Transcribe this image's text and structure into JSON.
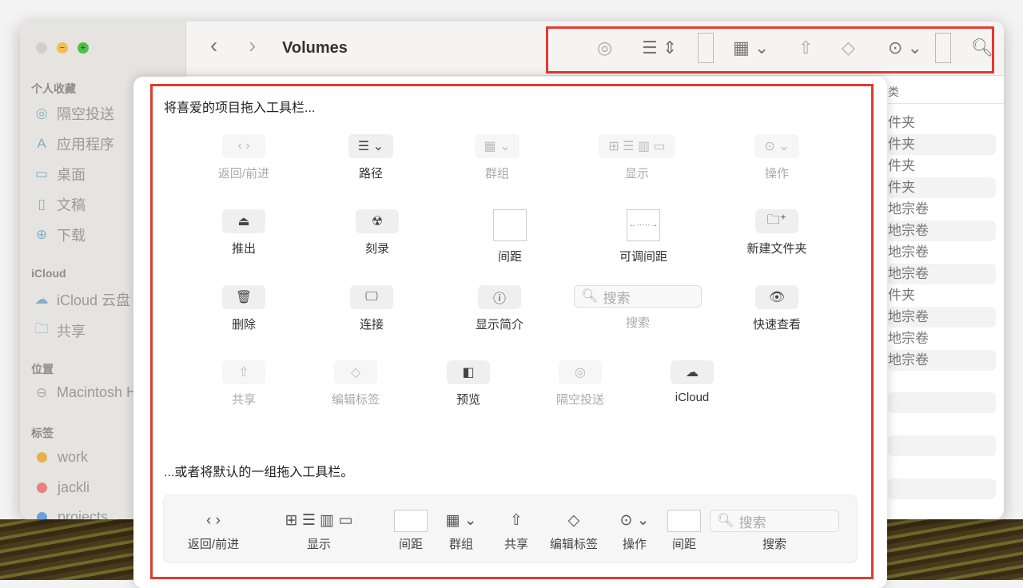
{
  "window": {
    "title": "Volumes"
  },
  "sidebar": {
    "favorites_header": "个人收藏",
    "favorites": [
      {
        "icon": "airdrop-icon",
        "label": "隔空投送"
      },
      {
        "icon": "applications-icon",
        "label": "应用程序"
      },
      {
        "icon": "desktop-icon",
        "label": "桌面"
      },
      {
        "icon": "document-icon",
        "label": "文稿"
      },
      {
        "icon": "download-icon",
        "label": "下载"
      }
    ],
    "icloud_header": "iCloud",
    "icloud": [
      {
        "icon": "cloud-icon",
        "label": "iCloud 云盘"
      },
      {
        "icon": "shared-folder-icon",
        "label": "共享"
      }
    ],
    "locations_header": "位置",
    "locations": [
      {
        "icon": "disk-icon",
        "label": "Macintosh HD"
      }
    ],
    "tags_header": "标签",
    "tags": [
      {
        "label": "work",
        "color": "#e8b04a"
      },
      {
        "label": "jackli",
        "color": "#e98080"
      },
      {
        "label": "projects",
        "color": "#6aa0e0"
      }
    ]
  },
  "list": {
    "column_header": "类",
    "rows": [
      "件夹",
      "件夹",
      "件夹",
      "件夹",
      "地宗卷",
      "地宗卷",
      "地宗卷",
      "地宗卷",
      "件夹",
      "地宗卷",
      "地宗卷",
      "地宗卷"
    ]
  },
  "sheet": {
    "drag_hint": "将喜爱的项目拖入工具栏...",
    "default_hint": "...或者将默认的一组拖入工具栏。",
    "items": [
      {
        "label": "返回/前进",
        "glyph": "‹  ›",
        "dim": true
      },
      {
        "label": "路径",
        "glyph": "☰ ⌄",
        "dim": false
      },
      {
        "label": "群组",
        "glyph": "▦ ⌄",
        "dim": true
      },
      {
        "label": "显示",
        "glyph": "⊞ ☰ ▥ ▭",
        "dim": true
      },
      {
        "label": "操作",
        "glyph": "⊙ ⌄",
        "dim": true
      },
      {
        "label": "推出",
        "glyph": "⏏",
        "dim": false
      },
      {
        "label": "刻录",
        "glyph": "☢",
        "dim": false
      },
      {
        "label": "间距",
        "glyph": "",
        "dim": false
      },
      {
        "label": "可调间距",
        "glyph": "←·····→",
        "dim": false
      },
      {
        "label": "新建文件夹",
        "glyph": "🗀⁺",
        "dim": false
      },
      {
        "label": "删除",
        "glyph": "🗑",
        "dim": false
      },
      {
        "label": "连接",
        "glyph": "🖵",
        "dim": false
      },
      {
        "label": "显示简介",
        "glyph": "ⓘ",
        "dim": false
      },
      {
        "label": "搜索",
        "glyph": "搜索",
        "dim": true
      },
      {
        "label": "快速查看",
        "glyph": "👁",
        "dim": false
      },
      {
        "label": "共享",
        "glyph": "⇧",
        "dim": true
      },
      {
        "label": "编辑标签",
        "glyph": "◇",
        "dim": true
      },
      {
        "label": "预览",
        "glyph": "◧",
        "dim": false
      },
      {
        "label": "隔空投送",
        "glyph": "◎",
        "dim": true
      },
      {
        "label": "iCloud",
        "glyph": "☁",
        "dim": false
      }
    ],
    "default_set": [
      {
        "label": "返回/前进",
        "glyph": "‹  ›"
      },
      {
        "label": "显示",
        "glyph": "⊞ ☰ ▥ ▭"
      },
      {
        "label": "间距",
        "glyph": ""
      },
      {
        "label": "群组",
        "glyph": "▦ ⌄"
      },
      {
        "label": "共享",
        "glyph": "⇧"
      },
      {
        "label": "编辑标签",
        "glyph": "◇"
      },
      {
        "label": "操作",
        "glyph": "⊙ ⌄"
      },
      {
        "label": "间距",
        "glyph": ""
      },
      {
        "label": "搜索",
        "glyph": "搜索"
      }
    ],
    "search_placeholder": "搜索"
  },
  "colors": {
    "highlight": "#e03c2e"
  }
}
